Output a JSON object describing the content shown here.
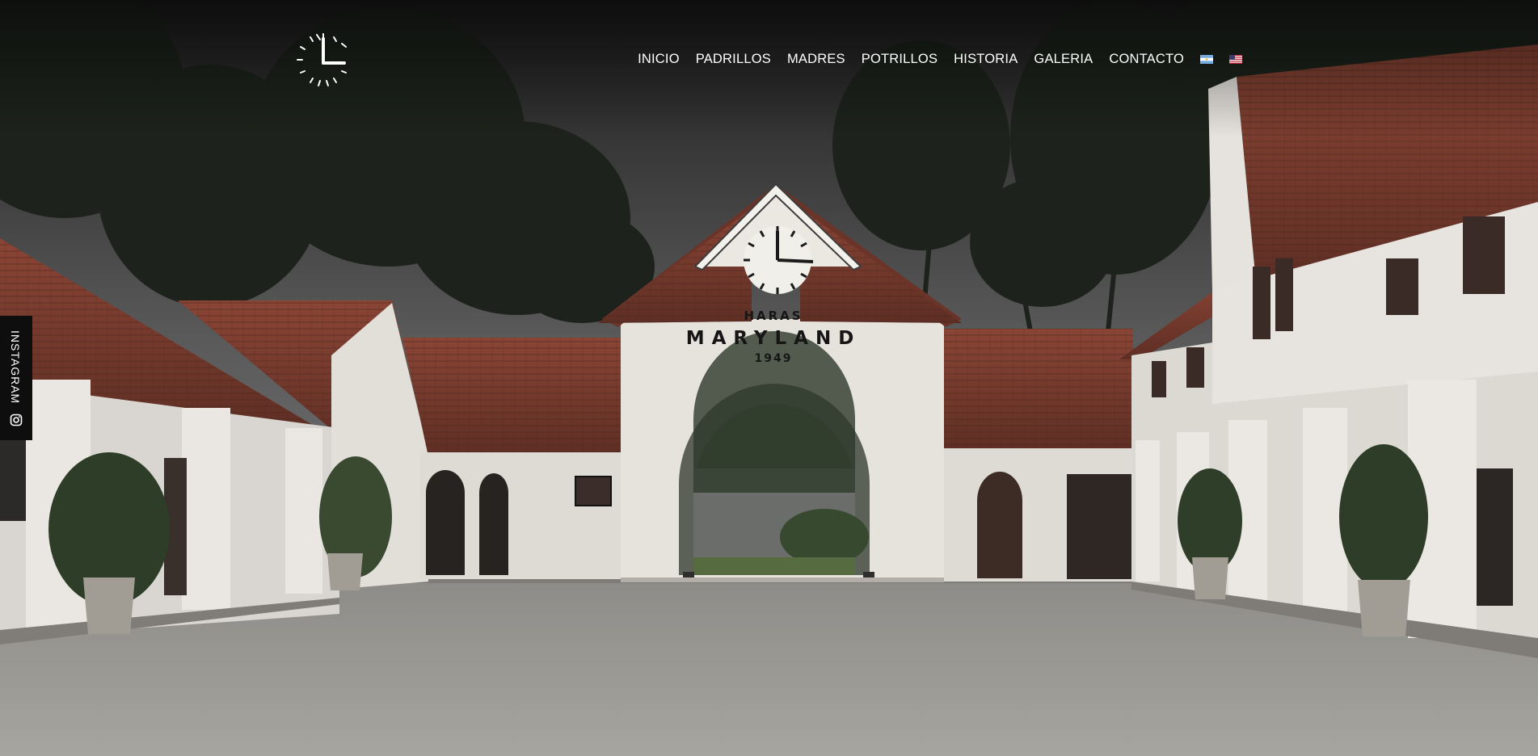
{
  "nav": {
    "items": [
      "INICIO",
      "PADRILLOS",
      "MADRES",
      "POTRILLOS",
      "HISTORIA",
      "GALERIA",
      "CONTACTO"
    ],
    "languages": [
      "es",
      "en"
    ]
  },
  "social": {
    "label": "INSTAGRAM",
    "icon": "instagram-icon"
  },
  "sign": {
    "line1": "HARAS",
    "line2": "MARYLAND",
    "line3": "1949"
  },
  "logo": {
    "icon": "clock-icon"
  },
  "colors": {
    "nav_text": "#ffffff",
    "sky": "#5e5e5e",
    "roof": "#7a3a2c",
    "wall": "#e3dfd8",
    "gravel": "#9c9a95"
  }
}
